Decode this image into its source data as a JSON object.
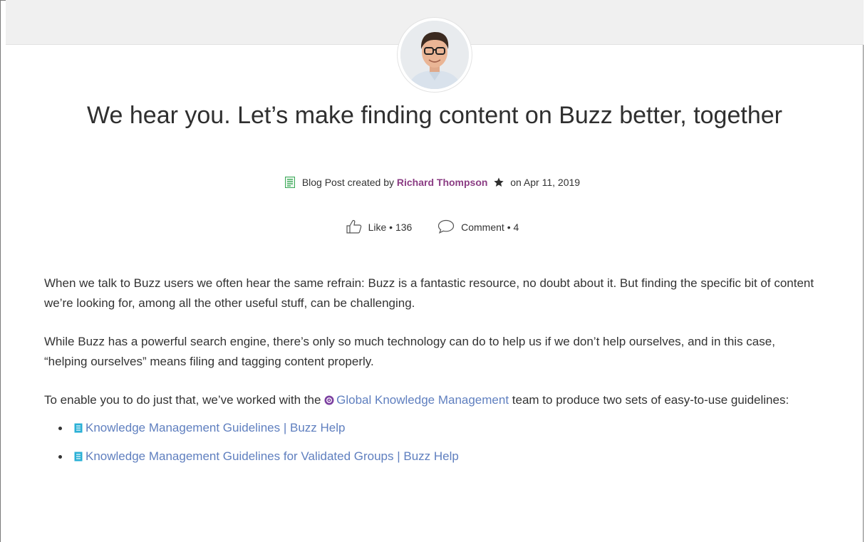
{
  "post": {
    "title": "We hear you. Let’s make finding content on Buzz better, together",
    "type_label": "Blog Post created by",
    "author": "Richard Thompson",
    "date_label": "on Apr 11, 2019"
  },
  "actions": {
    "like_label": "Like",
    "like_count": "136",
    "comment_label": "Comment",
    "comment_count": "4",
    "separator": "•"
  },
  "body": {
    "p1": "When we talk to Buzz users we often hear the same refrain: Buzz is a fantastic resource, no doubt about it. But finding the specific bit of content we’re looking for, among all the other useful stuff, can be challenging.",
    "p2": "While Buzz has a powerful search engine, there’s only so much technology can do to help us if we don’t help ourselves, and in this case, “helping ourselves” means filing and tagging content properly.",
    "p3_before": "To enable you to do just that, we’ve worked with the ",
    "p3_link": "Global Knowledge Management",
    "p3_after": " team to produce two sets of easy-to-use guidelines:",
    "links": [
      {
        "label": "Knowledge Management Guidelines | Buzz Help"
      },
      {
        "label": "Knowledge Management Guidelines for Validated Groups | Buzz Help"
      }
    ]
  },
  "icons": {
    "doc": "blog-post-icon",
    "star": "star-icon",
    "like": "thumbs-up-icon",
    "comment": "speech-bubble-icon",
    "group": "group-icon",
    "file": "document-icon"
  },
  "colors": {
    "author": "#8b3d84",
    "link": "#5f7fbf",
    "blog_icon": "#3aa857",
    "file_icon": "#2ab0d6",
    "group_icon": "#7b3fa0"
  }
}
